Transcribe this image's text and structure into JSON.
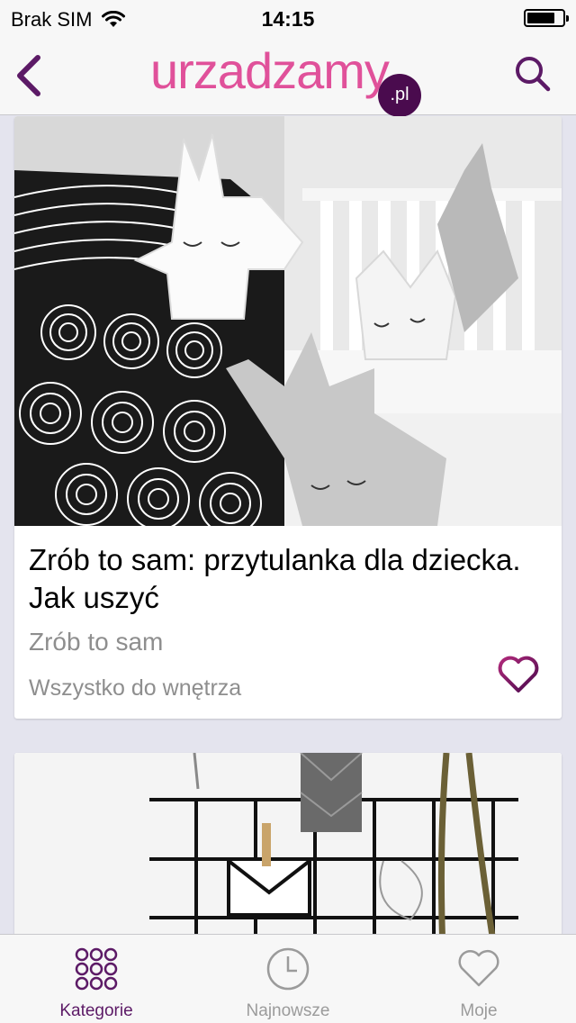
{
  "status_bar": {
    "carrier": "Brak SIM",
    "time": "14:15"
  },
  "nav": {
    "logo_text": "urzadzamy",
    "logo_suffix": ".pl"
  },
  "cards": [
    {
      "title": "Zrób to sam: przytulanka dla dziecka. Jak uszyć",
      "category": "Zrób to sam",
      "source": "Wszystko do wnętrza"
    }
  ],
  "tabs": [
    {
      "label": "Kategorie",
      "icon": "grid-dots-icon",
      "active": true
    },
    {
      "label": "Najnowsze",
      "icon": "clock-icon",
      "active": false
    },
    {
      "label": "Moje",
      "icon": "heart-icon",
      "active": false
    }
  ],
  "colors": {
    "accent": "#5c1a66",
    "logo_pink": "#e0519a",
    "badge_dark": "#4a0b4e",
    "inactive_tab": "#9b9b9b"
  }
}
